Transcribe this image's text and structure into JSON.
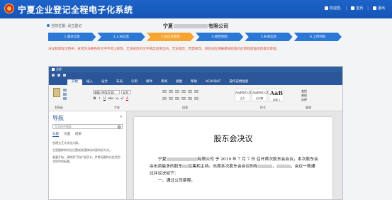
{
  "header": {
    "title": "宁夏企业登记全程电子化系统",
    "user_label": "欢迎您,",
    "home_label": "首页",
    "logout_label": "退出"
  },
  "location": {
    "label": "当前位置: 设立登记",
    "company_prefix": "宁夏",
    "company_suffix": "有限公司"
  },
  "steps": [
    "1.基本信息",
    "2.人员信息",
    "3.会议及章程",
    "4.经营范围",
    "5.补充信息",
    "6.上传材料"
  ],
  "active_step": 2,
  "notice": "决议和章程文档中，背景为浅黄色的文字不可以修改。无法修改的文字请自动带出的，无法修改，若需修改，请到对应填报模块后再对应章程后再修改提交章程。",
  "word": {
    "window_title": "全屏",
    "tabs": [
      "开始",
      "插入",
      "设计",
      "布局",
      "引用",
      "邮件",
      "审阅",
      "视图",
      "帮助",
      "ACROBAT",
      "操作说明搜索"
    ],
    "active_tab": 0,
    "ribbon": {
      "clipboard_label": "剪贴板",
      "font_label": "字体",
      "paragraph_label": "段落",
      "styles_label": "样式",
      "editing_label": "编辑",
      "font_name": "宋体 (中文正文)",
      "font_size": "五号",
      "format_buttons": [
        "B",
        "I",
        "U",
        "abc",
        "x₂",
        "x²",
        "A"
      ],
      "styles": [
        {
          "sample": "AaBbCcDd",
          "name": "正文"
        },
        {
          "sample": "AaBbCcDd",
          "name": "无间隔"
        },
        {
          "sample": "AaB",
          "name": "标题 1"
        }
      ],
      "editing_items": [
        "查找",
        "替换",
        "选择"
      ]
    },
    "nav": {
      "title": "导航",
      "search_placeholder": "在文档中搜索",
      "tabs": [
        "标题",
        "页面",
        "结果"
      ],
      "active_tab": 0,
      "text": [
        "创建交互式文档大纲。",
        "它是跟踪你所在位置或快速移动内容的好方式。",
        "若要开始，请转到\"开始\"选项卡，并将标题样式应用到文档中的标题。"
      ]
    },
    "doc": {
      "title": "股东会决议",
      "para1_a": "宁夏",
      "para1_b": "有限公司 于 2019 年 7 月 7 日 召开首次股东会会议，本次股东会由出资最多的股东",
      "para1_c": "召集和主持。出席本次股东会会议的有",
      "para1_d": "，",
      "para1_e": "，会议一致通过并议决如下：",
      "item1": "一、通过公司章程。"
    }
  },
  "colors": {
    "banner": "#1d63c8",
    "step": "#2b77d6",
    "step_active": "#f7a431",
    "notice": "#e24a2b",
    "word_blue": "#2b579a"
  }
}
